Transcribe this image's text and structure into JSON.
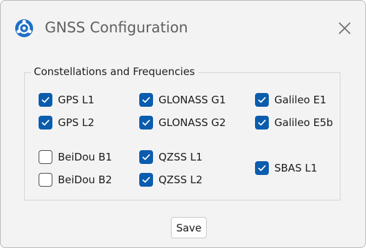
{
  "window": {
    "title": "GNSS Configuration"
  },
  "group": {
    "title": "Constellations and Frequencies"
  },
  "checkboxes": {
    "gps_l1": {
      "label": "GPS L1",
      "checked": true
    },
    "gps_l2": {
      "label": "GPS L2",
      "checked": true
    },
    "glonass_g1": {
      "label": "GLONASS G1",
      "checked": true
    },
    "glonass_g2": {
      "label": "GLONASS G2",
      "checked": true
    },
    "galileo_e1": {
      "label": "Galileo E1",
      "checked": true
    },
    "galileo_e5b": {
      "label": "Galileo E5b",
      "checked": true
    },
    "beidou_b1": {
      "label": "BeiDou B1",
      "checked": false
    },
    "beidou_b2": {
      "label": "BeiDou B2",
      "checked": false
    },
    "qzss_l1": {
      "label": "QZSS L1",
      "checked": true
    },
    "qzss_l2": {
      "label": "QZSS L2",
      "checked": true
    },
    "sbas_l1": {
      "label": "SBAS L1",
      "checked": true
    }
  },
  "buttons": {
    "save_label": "Save"
  },
  "icons": {
    "app": "satellite-app-icon",
    "close": "close-icon",
    "check": "checkmark-icon"
  },
  "colors": {
    "accent": "#0b5cad",
    "window_bg": "#f3f3f3"
  }
}
